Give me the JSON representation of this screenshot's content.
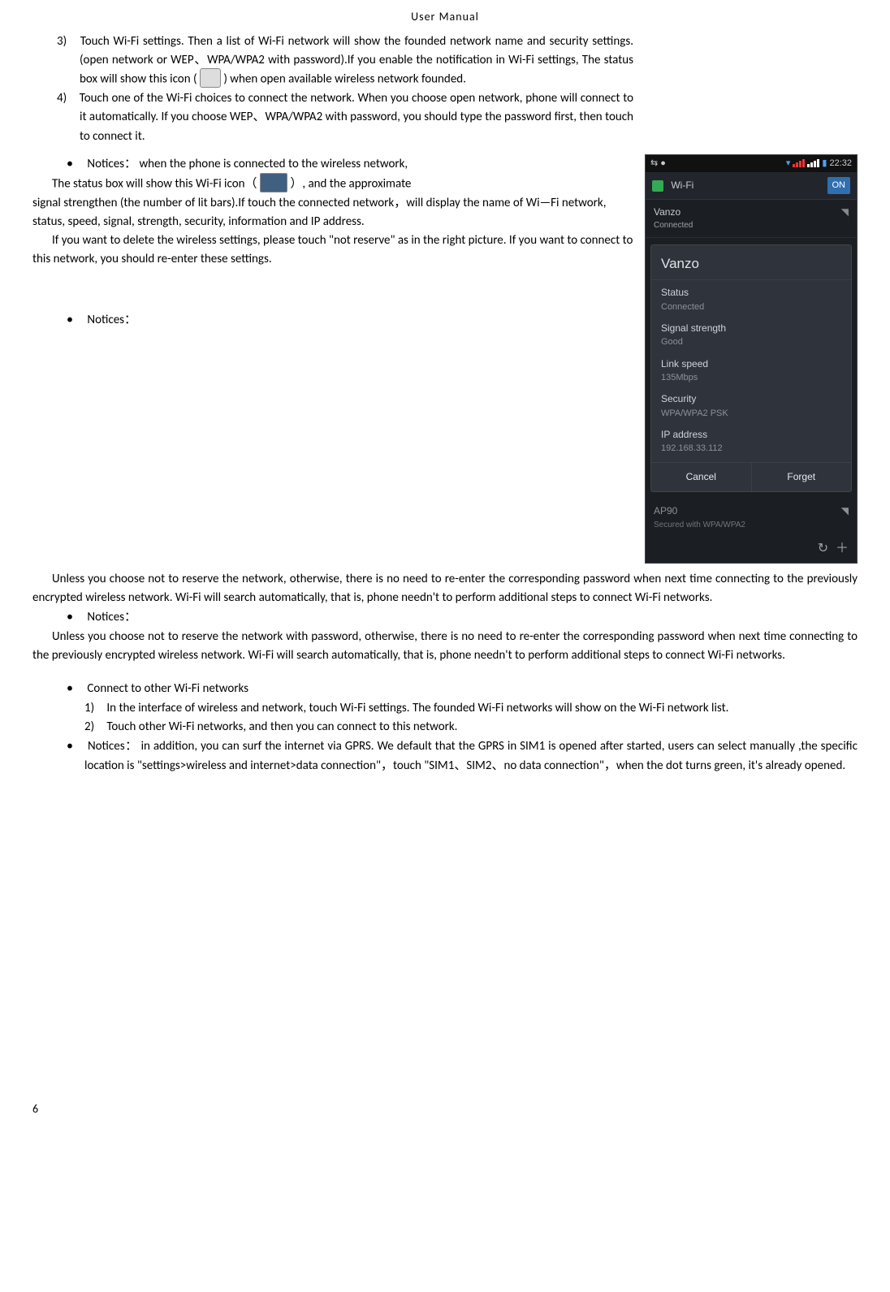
{
  "header": "User    Manual",
  "item3_num": "3)",
  "item3_text_a": "Touch Wi-Fi settings. Then a list of Wi-Fi network will show the founded network name and security settings. (open network or WEP、WPA/WPA2 with password).If you enable the notification in    Wi-Fi settings, The status box will show this icon (",
  "item3_text_b": ") when open available wireless network founded.",
  "item4_num": "4)",
  "item4_text": "Touch one of the Wi-Fi choices to connect the network. When you choose open network, phone will connect to it automatically. If you choose WEP、WPA/WPA2 with password, you should type the password first, then touch to connect it.",
  "notices1_label": "Notices：",
  "notices1_text": "when the phone is connected to the wireless network,",
  "para_statusbox_a": "The status box will show this Wi-Fi icon（",
  "para_statusbox_b": "）, and the approximate",
  "para_signal": "signal strengthen (the number of lit bars).If touch the connected network，will display the name of Wi—Fi    network, status, speed,    signal, strength, security, information and IP address.",
  "para_delete": "If you want to delete the wireless settings, please touch \"not reserve\" as in the right picture. If you want to connect to this network, you should re-enter these settings.",
  "notices2_label": "Notices：",
  "notices2_para": "Unless you choose not to reserve the network, otherwise, there is no need to re-enter the corresponding password when next time connecting to the previously encrypted wireless network. Wi-Fi will search automatically, that is, phone needn't to perform additional steps to connect Wi-Fi networks.",
  "notices3_label": "Notices：",
  "notices3_para": "Unless you choose not to reserve the network with password, otherwise, there is no need to re-enter the corresponding password when next time connecting to the previously encrypted wireless network. Wi-Fi will search automatically, that is, phone needn't to perform additional steps to connect Wi-Fi networks.",
  "connect_other_label": "Connect to other Wi-Fi networks",
  "connect_sub1_num": "1)",
  "connect_sub1_text": "In the interface of wireless and network, touch Wi-Fi settings. The founded Wi-Fi networks will show on the Wi-Fi network list.",
  "connect_sub2_num": "2)",
  "connect_sub2_text": "Touch other Wi-Fi networks, and then you can connect to this network.",
  "notices4_label": "Notices：",
  "notices4_text": "in addition, you can surf the internet via GPRS. We default that the GPRS in SIM1 is opened after started, users can select manually ,the specific location is  \"settings>wireless and internet>data connection\"，touch \"SIM1、SIM2、no data connection\"，when the dot turns green, it's already opened.",
  "page_number": "6",
  "phone": {
    "time": "22:32",
    "wifi_label": "Wi-Fi",
    "on_label": "ON",
    "ssid1": "Vanzo",
    "ssid1_sub": "Connected",
    "popup_title": "Vanzo",
    "status_k": "Status",
    "status_v": "Connected",
    "signal_k": "Signal strength",
    "signal_v": "Good",
    "speed_k": "Link speed",
    "speed_v": "135Mbps",
    "security_k": "Security",
    "security_v": "WPA/WPA2 PSK",
    "ip_k": "IP address",
    "ip_v": "192.168.33.112",
    "cancel": "Cancel",
    "forget": "Forget",
    "ap90": "AP90",
    "ap90_sub": "Secured with WPA/WPA2"
  }
}
